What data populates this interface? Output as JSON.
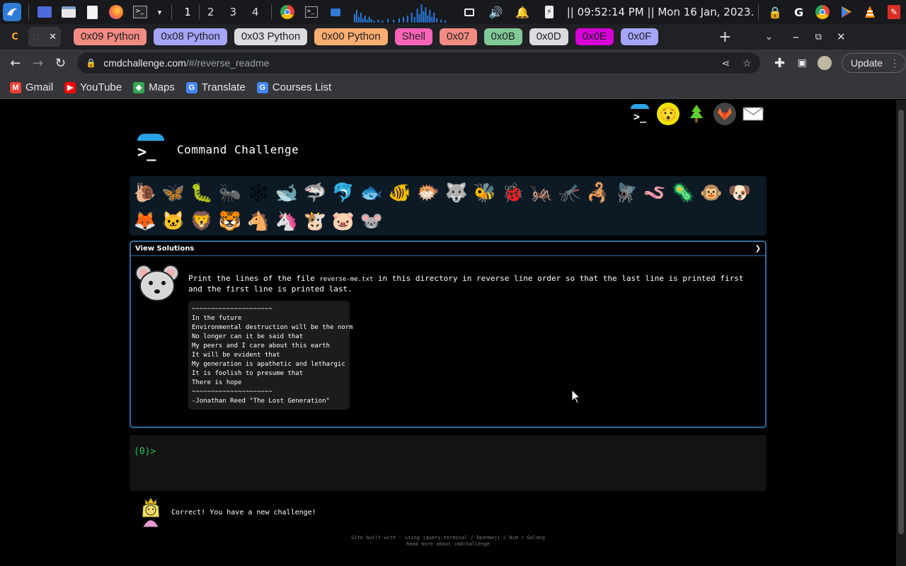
{
  "taskbar": {
    "workspaces": [
      "1",
      "2",
      "3",
      "4"
    ],
    "clock": "|| 09:52:14 PM || Mon 16 Jan, 2023."
  },
  "tabs": {
    "active_close": "✕",
    "groups": [
      {
        "label": "0x09 Python",
        "color": "#f28b82"
      },
      {
        "label": "0x08 Python",
        "color": "#a5a5f8"
      },
      {
        "label": "0x03 Python",
        "color": "#dadce0"
      },
      {
        "label": "0x00 Python",
        "color": "#fcad70"
      },
      {
        "label": "Shell",
        "color": "#ff63b8"
      },
      {
        "label": "0x07",
        "color": "#f28b82"
      },
      {
        "label": "0x0B",
        "color": "#81c995"
      },
      {
        "label": "0x0D",
        "color": "#dadce0"
      },
      {
        "label": "0x0E",
        "color": "#d600d6"
      },
      {
        "label": "0x0F",
        "color": "#a5a5f8"
      }
    ],
    "new_tab": "+"
  },
  "address": {
    "host": "cmdchallenge.com",
    "path": "/#/reverse_readme",
    "update_label": "Update"
  },
  "bookmarks": [
    {
      "label": "Gmail",
      "icon": "gmail-icon",
      "color": "#ea4335",
      "glyph": "M"
    },
    {
      "label": "YouTube",
      "icon": "youtube-icon",
      "color": "#ff0000",
      "glyph": "▶"
    },
    {
      "label": "Maps",
      "icon": "maps-icon",
      "color": "#34a853",
      "glyph": "◆"
    },
    {
      "label": "Translate",
      "icon": "translate-icon",
      "color": "#4285f4",
      "glyph": "G"
    },
    {
      "label": "Courses List",
      "icon": "google-icon",
      "color": "#4285f4",
      "glyph": "G"
    }
  ],
  "page": {
    "brand_title": "Command Challenge",
    "brand_prompt": ">_",
    "emojis": [
      "🐌",
      "🦋",
      "🐛",
      "🐜",
      "🕸",
      "🐋",
      "🦈",
      "🐬",
      "🐟",
      "🐠",
      "🐡",
      "🐺",
      "🐝",
      "🐞",
      "🦗",
      "🦟",
      "🦂",
      "🪰",
      "🪱",
      "🦠",
      "🐵",
      "🐶",
      "🦊",
      "🐱",
      "🦁",
      "🐯",
      "🐴",
      "🦄",
      "🐮",
      "🐷",
      "🐭"
    ],
    "view_solutions_label": "View Solutions",
    "view_solutions_chevron": "❯",
    "task": {
      "before": "Print the lines of the file ",
      "filename": "reverse-me.txt",
      "after": " in this directory in reverse line order so that the last line is printed first and the first line is printed last."
    },
    "readme_lines": [
      "~~~~~~~~~~~~~~~~~~~~~",
      "In the future",
      "Environmental destruction will be the norm",
      "No longer can it be said that",
      "My peers and I care about this earth",
      "It will be evident that",
      "My generation is apathetic and lethargic",
      "It is foolish to presume that",
      "There is hope",
      "~~~~~~~~~~~~~~~~~~~~~",
      "-Jonathan Reed \"The Lost Generation\""
    ],
    "terminal_prompt": "(0)>",
    "feedback": "Correct! You have a new challenge!",
    "footer_line1": "Site built with ♡ using jquery.terminal / Openmoji / Nim / Golang",
    "footer_line2": "Read more about cmdchallenge"
  }
}
